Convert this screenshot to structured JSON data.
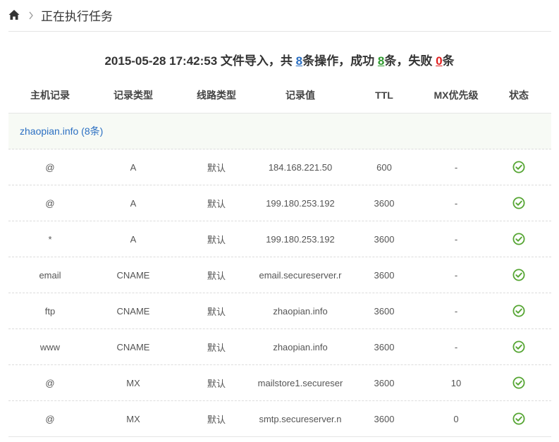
{
  "breadcrumb": {
    "current": "正在执行任务"
  },
  "summary": {
    "prefix": "2015-05-28 17:42:53 文件导入，",
    "total_label": "共",
    "total": "8",
    "total_unit": "条操作，",
    "success_label": "成功",
    "success": "8",
    "success_unit": "条，",
    "fail_label": "失败",
    "fail": "0",
    "fail_unit": "条"
  },
  "table": {
    "headers": [
      "主机记录",
      "记录类型",
      "线路类型",
      "记录值",
      "TTL",
      "MX优先级",
      "状态"
    ],
    "group": "zhaopian.info (8条)",
    "rows": [
      {
        "host": "@",
        "type": "A",
        "line": "默认",
        "value": "184.168.221.50",
        "ttl": "600",
        "mx": "-"
      },
      {
        "host": "@",
        "type": "A",
        "line": "默认",
        "value": "199.180.253.192",
        "ttl": "3600",
        "mx": "-"
      },
      {
        "host": "*",
        "type": "A",
        "line": "默认",
        "value": "199.180.253.192",
        "ttl": "3600",
        "mx": "-"
      },
      {
        "host": "email",
        "type": "CNAME",
        "line": "默认",
        "value": "email.secureserver.r",
        "ttl": "3600",
        "mx": "-"
      },
      {
        "host": "ftp",
        "type": "CNAME",
        "line": "默认",
        "value": "zhaopian.info",
        "ttl": "3600",
        "mx": "-"
      },
      {
        "host": "www",
        "type": "CNAME",
        "line": "默认",
        "value": "zhaopian.info",
        "ttl": "3600",
        "mx": "-"
      },
      {
        "host": "@",
        "type": "MX",
        "line": "默认",
        "value": "mailstore1.secureser",
        "ttl": "3600",
        "mx": "10"
      },
      {
        "host": "@",
        "type": "MX",
        "line": "默认",
        "value": "smtp.secureserver.n",
        "ttl": "3600",
        "mx": "0"
      }
    ]
  },
  "colors": {
    "accent": "#2b6fc2",
    "success": "#2f9a2f",
    "fail": "#e02020",
    "ok_icon": "#55a532"
  },
  "icons": {
    "home": "home-icon",
    "separator": "chevron-right-icon",
    "status": "check-circle-icon"
  }
}
